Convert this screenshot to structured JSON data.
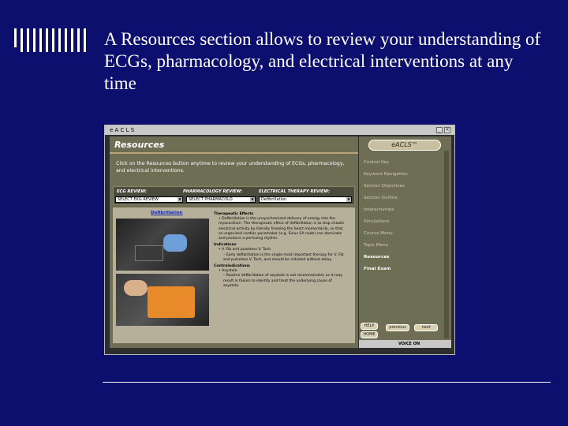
{
  "slide": {
    "title": "A Resources section allows to review your understanding of ECGs, pharmacology, and electrical interventions at any time"
  },
  "window": {
    "title": "e A C L S",
    "section_title": "Resources",
    "intro": "Click on the Resources button anytime to review your understanding of ECGs, pharmacology, and electrical interventions.",
    "headers": {
      "ecg": "ECG REVIEW:",
      "pharm": "PHARMACOLOGY REVIEW:",
      "elec": "ELECTRICAL THERAPY REVIEW:"
    },
    "selects": {
      "ecg": "SELECT EKG REVIEW",
      "pharm": "SELECT PHARMACOLO",
      "elec": "Defibrillation"
    },
    "link": "Defibrillation",
    "content": {
      "h1": "Therapeutic Effects",
      "p1": "• Defibrillation is the unsynchronized delivery of energy into the myocardium. The therapeutic effect of defibrillation is to stop chaotic electrical activity by literally freezing the heart momentarily, so that an organized cardiac pacemaker (e.g. Sinus SA node) can dominate and produce a perfusing rhythm.",
      "h2": "Indications",
      "p2": "• V. Fib and pulseless V. Tach",
      "p3": "– Early defibrillation is the single most important therapy for V. Fib and pulseless V. Tach, and should be initiated without delay.",
      "h3": "Contraindications",
      "p4": "• Asystole",
      "p5": "– Routine defibrillation of asystole is not recommended, as it may result in failure to identify and treat the underlying cause of asystole."
    },
    "logo": "eACLS™",
    "nav": [
      "Control Key",
      "Keyword Navigation",
      "Section Objectives",
      "Section Outline",
      "Interactivities",
      "Simulations",
      "Course Menu",
      "Topic Menu",
      "Resources",
      "Final Exam"
    ],
    "buttons": {
      "help": "HELP",
      "home": "HOME",
      "prev": "previous",
      "next": "next"
    },
    "voice": "VOICE ON"
  }
}
